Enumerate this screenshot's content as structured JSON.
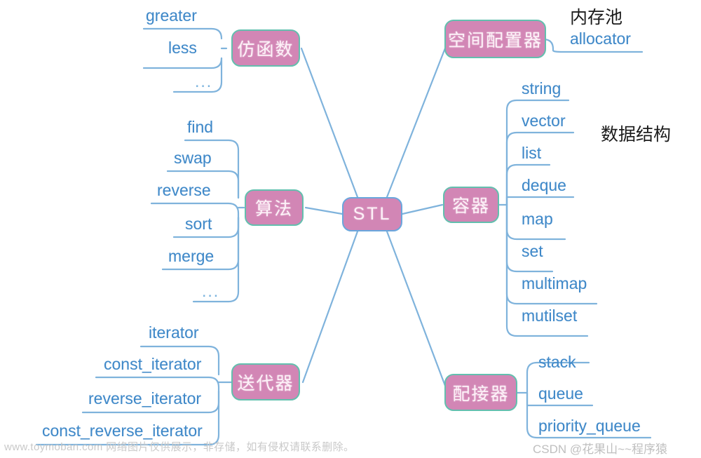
{
  "diagram": {
    "title": "STL",
    "center": {
      "label": "STL"
    },
    "branches": [
      {
        "key": "functor",
        "label": "仿函数",
        "side": "left",
        "items": [
          {
            "label": "greater"
          },
          {
            "label": "less"
          },
          {
            "label": "..."
          }
        ]
      },
      {
        "key": "allocator",
        "label": "空间配置器",
        "side": "right",
        "annotation": "内存池",
        "items": [
          {
            "label": "allocator"
          }
        ]
      },
      {
        "key": "algorithm",
        "label": "算法",
        "side": "left",
        "items": [
          {
            "label": "find"
          },
          {
            "label": "swap"
          },
          {
            "label": "reverse"
          },
          {
            "label": "sort"
          },
          {
            "label": "merge"
          },
          {
            "label": "..."
          }
        ]
      },
      {
        "key": "container",
        "label": "容器",
        "side": "right",
        "annotation": "数据结构",
        "items": [
          {
            "label": "string"
          },
          {
            "label": "vector"
          },
          {
            "label": "list"
          },
          {
            "label": "deque"
          },
          {
            "label": "map"
          },
          {
            "label": "set"
          },
          {
            "label": "multimap"
          },
          {
            "label": "mutilset"
          }
        ]
      },
      {
        "key": "iterator",
        "label": "送代器",
        "side": "left",
        "items": [
          {
            "label": "iterator"
          },
          {
            "label": "const_iterator"
          },
          {
            "label": "reverse_iterator"
          },
          {
            "label": "const_reverse_iterator"
          }
        ]
      },
      {
        "key": "adapter",
        "label": "配接器",
        "side": "right",
        "items": [
          {
            "label": "stack"
          },
          {
            "label": "queue"
          },
          {
            "label": "priority_queue"
          }
        ]
      }
    ],
    "colors": {
      "node_fill": "#d286b5",
      "node_text": "#fdf2f8",
      "central_border": "#6aa7dd",
      "branch_border": "#63bfae",
      "wire": "#7fb3dc",
      "leaf_text": "#3f88c8",
      "annotation_text": "#1b1b1b",
      "background": "#ffffff"
    }
  },
  "watermarks": {
    "left": "www.toymoban.com 网络图片仅供展示，非存储，如有侵权请联系删除。",
    "right": "CSDN @花果山~~程序猿"
  }
}
